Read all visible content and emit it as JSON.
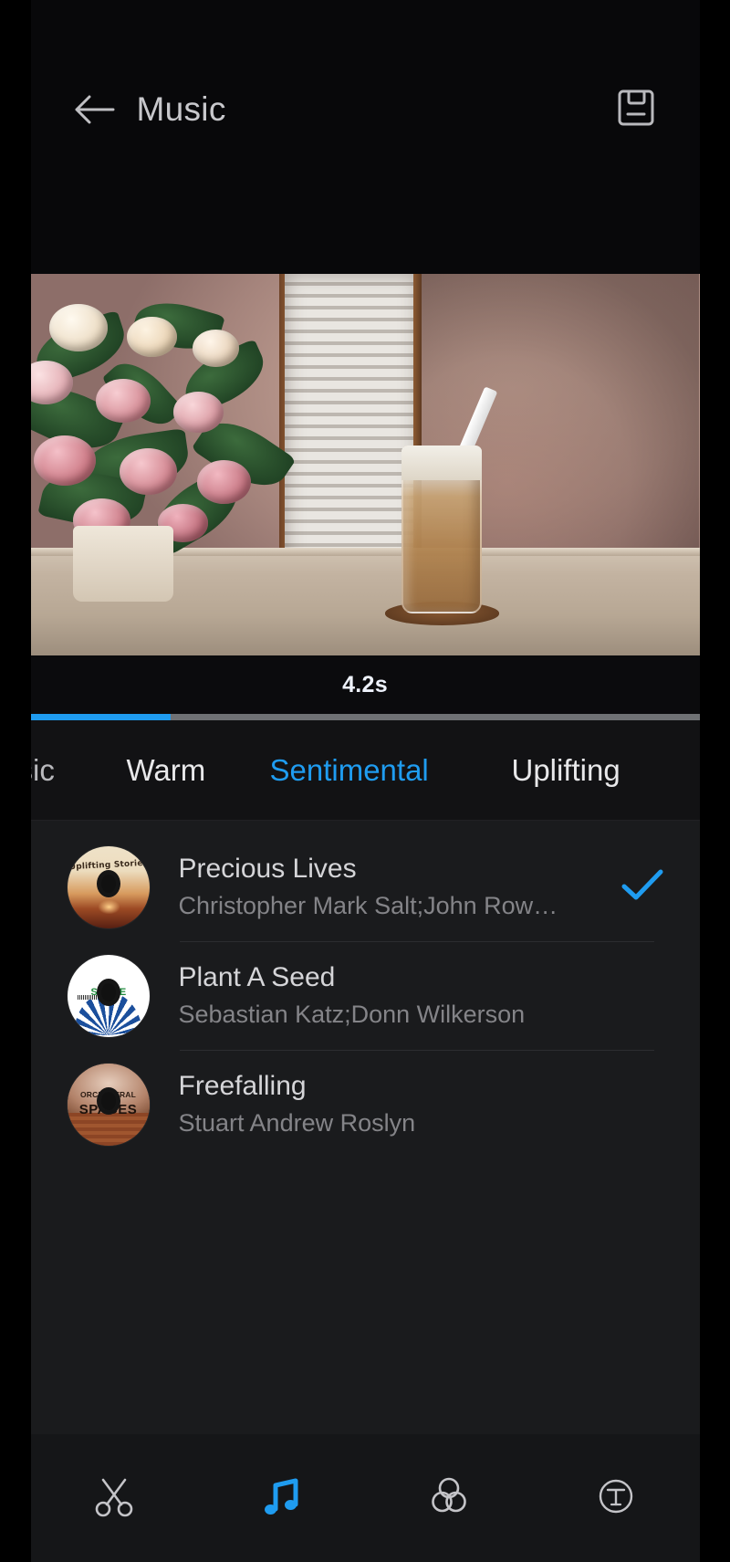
{
  "appbar": {
    "title": "Music",
    "back_icon": "arrow-left-icon",
    "save_icon": "save-floppy-icon"
  },
  "preview": {
    "duration": "4.2s",
    "progress_percent": 21,
    "accent_color": "#1f9cf0"
  },
  "tabs": [
    {
      "label": "sic",
      "active": false,
      "clipped": true
    },
    {
      "label": "Warm",
      "active": false,
      "clipped": false
    },
    {
      "label": "Sentimental",
      "active": true,
      "clipped": false
    },
    {
      "label": "Uplifting",
      "active": false,
      "clipped": false
    }
  ],
  "songs": [
    {
      "title": "Precious Lives",
      "artist": "Christopher Mark Salt;John  Row…",
      "selected": true,
      "cover_label": "Uplifting Stories",
      "cover_label2": ""
    },
    {
      "title": "Plant A Seed",
      "artist": "Sebastian  Katz;Donn  Wilkerson",
      "selected": false,
      "cover_label": "SCENE",
      "cover_label2": ""
    },
    {
      "title": "Freefalling",
      "artist": "Stuart Andrew Roslyn",
      "selected": false,
      "cover_label": "ORCHESTRAL",
      "cover_label2": "SPACES"
    }
  ],
  "toolbar": [
    {
      "icon": "scissors-trim-icon",
      "active": false
    },
    {
      "icon": "music-note-icon",
      "active": true
    },
    {
      "icon": "filter-circles-icon",
      "active": false
    },
    {
      "icon": "text-t-icon",
      "active": false
    }
  ]
}
